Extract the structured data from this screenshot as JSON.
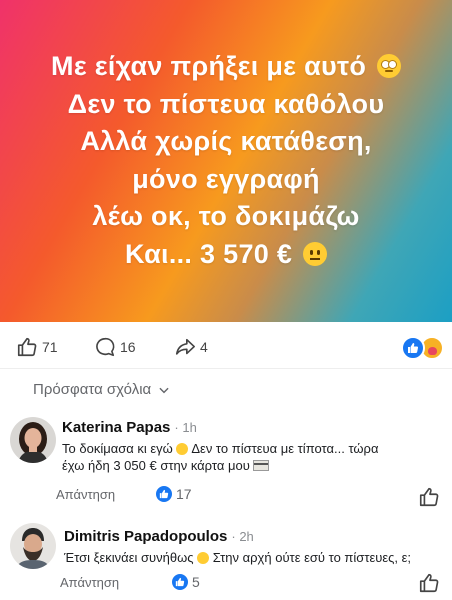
{
  "post": {
    "lines": [
      "Με είχαν πρήξει με αυτό",
      "Δεν το πίστευα καθόλου",
      "Αλλά χωρίς κατάθεση,",
      "μόνο εγγραφή",
      "λέω οκ, το δοκιμάζω",
      "Και... 3 570 €"
    ],
    "line1_emoji": "face-with-rolling-eyes",
    "line6_emoji": "neutral-face",
    "likes": "71",
    "comments": "16",
    "shares": "4",
    "colors": {
      "gradient": [
        "#f0326a",
        "#f45a2c",
        "#f79a1e",
        "#1c9fc4"
      ],
      "like_blue": "#1877f2"
    }
  },
  "comments_header": "Πρόσφατα σχόλια",
  "comments": [
    {
      "name": "Katerina Papas",
      "time": "1h",
      "text_line1": "Το δοκίμασα κι εγώ",
      "text_line1_rest": "Δεν το πίστευα με τίποτα... τώρα",
      "text_line2": "έχω ήδη 3 050 € στην κάρτα μου",
      "reply": "Απάντηση",
      "likes": "17"
    },
    {
      "name": "Dimitris Papadopoulos",
      "time": "2h",
      "text_line1": "Έτσι ξεκινάει συνήθως",
      "text_line1_rest": "Στην αρχή ούτε εσύ το πίστευες, ε;",
      "reply": "Απάντηση",
      "likes": "5"
    }
  ]
}
